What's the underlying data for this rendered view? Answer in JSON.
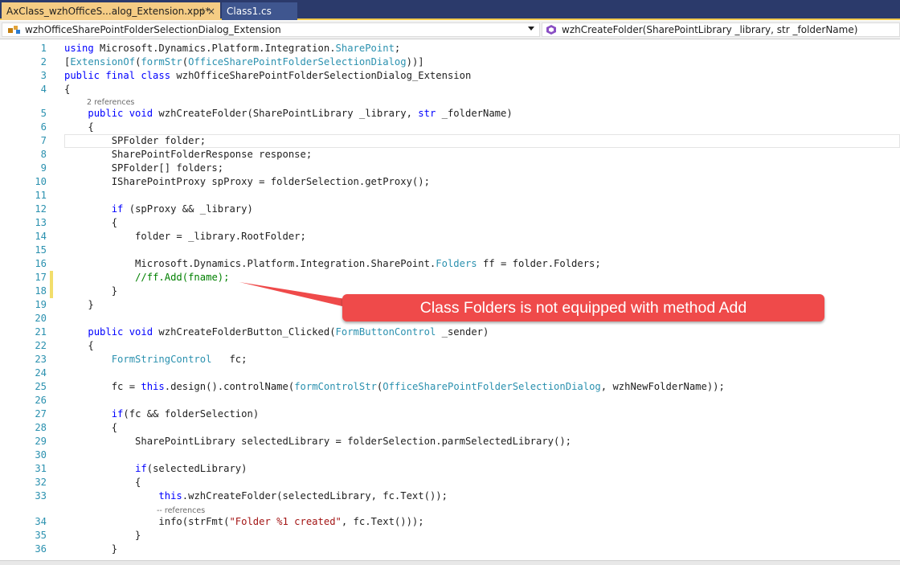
{
  "tabs": [
    {
      "label": "AxClass_wzhOfficeS...alog_Extension.xpp*",
      "pin": "⊣",
      "close": "×"
    },
    {
      "label": "Class1.cs"
    }
  ],
  "navbar": {
    "class_name": "wzhOfficeSharePointFolderSelectionDialog_Extension",
    "method_signature": "wzhCreateFolder(SharePointLibrary _library, str _folderName)"
  },
  "lines": [
    {
      "n": "1",
      "tokens": [
        [
          "using ",
          "kw"
        ],
        [
          "Microsoft.Dynamics.Platform.Integration.",
          ""
        ],
        [
          "SharePoint",
          "ty"
        ],
        [
          ";",
          ""
        ]
      ]
    },
    {
      "n": "2",
      "tokens": [
        [
          "[",
          ""
        ],
        [
          "ExtensionOf",
          "ty"
        ],
        [
          "(",
          ""
        ],
        [
          "formStr",
          "ty"
        ],
        [
          "(",
          ""
        ],
        [
          "OfficeSharePointFolderSelectionDialog",
          "ty"
        ],
        [
          "))]",
          ""
        ]
      ]
    },
    {
      "n": "3",
      "tokens": [
        [
          "public final class ",
          "kw"
        ],
        [
          "wzhOfficeSharePointFolderSelectionDialog_Extension",
          ""
        ]
      ]
    },
    {
      "n": "4",
      "tokens": [
        [
          "{",
          ""
        ]
      ]
    },
    {
      "n": "5",
      "refs": "2 references",
      "tokens": [
        [
          "    ",
          ""
        ],
        [
          "public void ",
          "kw"
        ],
        [
          "wzhCreateFolder(SharePointLibrary _library, ",
          ""
        ],
        [
          "str",
          "kw"
        ],
        [
          " _folderName)",
          ""
        ]
      ]
    },
    {
      "n": "6",
      "tokens": [
        [
          "    {",
          ""
        ]
      ]
    },
    {
      "n": "7",
      "tokens": [
        [
          "        SPFolder folder;",
          ""
        ]
      ]
    },
    {
      "n": "8",
      "tokens": [
        [
          "        SharePointFolderResponse response;",
          ""
        ]
      ]
    },
    {
      "n": "9",
      "tokens": [
        [
          "        SPFolder[] folders;",
          ""
        ]
      ]
    },
    {
      "n": "10",
      "tokens": [
        [
          "        ISharePointProxy spProxy = folderSelection.getProxy();",
          ""
        ]
      ]
    },
    {
      "n": "11",
      "tokens": []
    },
    {
      "n": "12",
      "tokens": [
        [
          "        ",
          ""
        ],
        [
          "if",
          "kw"
        ],
        [
          " (spProxy && _library)",
          ""
        ]
      ]
    },
    {
      "n": "13",
      "tokens": [
        [
          "        {",
          ""
        ]
      ]
    },
    {
      "n": "14",
      "tokens": [
        [
          "            folder = _library.RootFolder;",
          ""
        ]
      ]
    },
    {
      "n": "15",
      "tokens": []
    },
    {
      "n": "16",
      "tokens": [
        [
          "            Microsoft.Dynamics.Platform.Integration.SharePoint.",
          ""
        ],
        [
          "Folders",
          "ty"
        ],
        [
          " ff = folder.Folders;",
          ""
        ]
      ]
    },
    {
      "n": "17",
      "tokens": [
        [
          "            ",
          ""
        ],
        [
          "//ff.Add(fname);",
          "cm"
        ]
      ]
    },
    {
      "n": "18",
      "tokens": [
        [
          "        }",
          ""
        ]
      ]
    },
    {
      "n": "19",
      "tokens": [
        [
          "    }",
          ""
        ]
      ]
    },
    {
      "n": "20",
      "tokens": []
    },
    {
      "n": "21",
      "tokens": [
        [
          "    ",
          ""
        ],
        [
          "public void ",
          "kw"
        ],
        [
          "wzhCreateFolderButton_Clicked(",
          ""
        ],
        [
          "FormButtonControl",
          "ty"
        ],
        [
          " _sender)",
          ""
        ]
      ]
    },
    {
      "n": "22",
      "tokens": [
        [
          "    {",
          ""
        ]
      ]
    },
    {
      "n": "23",
      "tokens": [
        [
          "        ",
          ""
        ],
        [
          "FormStringControl",
          "ty"
        ],
        [
          "   fc;",
          ""
        ]
      ]
    },
    {
      "n": "24",
      "tokens": []
    },
    {
      "n": "25",
      "tokens": [
        [
          "        fc = ",
          ""
        ],
        [
          "this",
          "kw"
        ],
        [
          ".design().controlName(",
          ""
        ],
        [
          "formControlStr",
          "ty"
        ],
        [
          "(",
          ""
        ],
        [
          "OfficeSharePointFolderSelectionDialog",
          "ty"
        ],
        [
          ", wzhNewFolderName));",
          ""
        ]
      ]
    },
    {
      "n": "26",
      "tokens": []
    },
    {
      "n": "27",
      "tokens": [
        [
          "        ",
          ""
        ],
        [
          "if",
          "kw"
        ],
        [
          "(fc && folderSelection)",
          ""
        ]
      ]
    },
    {
      "n": "28",
      "tokens": [
        [
          "        {",
          ""
        ]
      ]
    },
    {
      "n": "29",
      "tokens": [
        [
          "            SharePointLibrary selectedLibrary = folderSelection.parmSelectedLibrary();",
          ""
        ]
      ]
    },
    {
      "n": "30",
      "tokens": []
    },
    {
      "n": "31",
      "tokens": [
        [
          "            ",
          ""
        ],
        [
          "if",
          "kw"
        ],
        [
          "(selectedLibrary)",
          ""
        ]
      ]
    },
    {
      "n": "32",
      "tokens": [
        [
          "            {",
          ""
        ]
      ]
    },
    {
      "n": "33",
      "tokens": [
        [
          "                ",
          ""
        ],
        [
          "this",
          "kw"
        ],
        [
          ".wzhCreateFolder(selectedLibrary, fc.Text());",
          ""
        ]
      ]
    },
    {
      "n": "34",
      "refs": "-- references",
      "tokens": [
        [
          "                info(strFmt(",
          ""
        ],
        [
          "\"Folder %1 created\"",
          "str"
        ],
        [
          ", fc.Text()));",
          ""
        ]
      ]
    },
    {
      "n": "35",
      "tokens": [
        [
          "            }",
          ""
        ]
      ]
    },
    {
      "n": "36",
      "tokens": [
        [
          "        }",
          ""
        ]
      ]
    }
  ],
  "callout": {
    "text": "Class Folders is not equipped with method Add",
    "color": "#ef4a4a"
  },
  "colors": {
    "keyword": "#0000ff",
    "type": "#2b91af",
    "string": "#a31515",
    "comment": "#008000",
    "tab_bar": "#2b3a6b",
    "active_tab": "#f5cc84"
  },
  "icons": {
    "class": "class-icon",
    "method": "method-icon",
    "pin": "pin-icon",
    "close": "close-icon",
    "dropdown": "chevron-down-icon"
  }
}
